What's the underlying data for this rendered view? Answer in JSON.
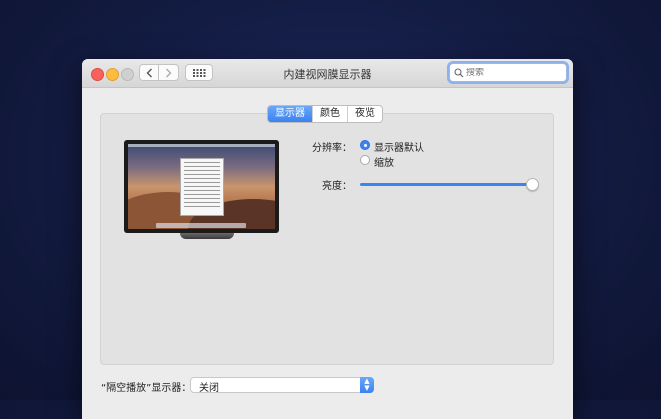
{
  "window": {
    "title": "内建视网膜显示器"
  },
  "search": {
    "value": "",
    "placeholder": "搜索"
  },
  "tabs": [
    {
      "label": "显示器",
      "active": true
    },
    {
      "label": "颜色",
      "active": false
    },
    {
      "label": "夜览",
      "active": false
    }
  ],
  "display": {
    "resolution_label": "分辨率：",
    "resolution_options": [
      {
        "label": "显示器默认",
        "selected": true
      },
      {
        "label": "缩放",
        "selected": false
      }
    ],
    "brightness_label": "亮度：",
    "brightness_value": 1.0
  },
  "airplay": {
    "label": "“隔空播放”显示器：",
    "selected": "关闭"
  },
  "colors": {
    "accent": "#3d83f2",
    "window_bg": "#ececec",
    "panel_bg": "#e2e2e2"
  }
}
